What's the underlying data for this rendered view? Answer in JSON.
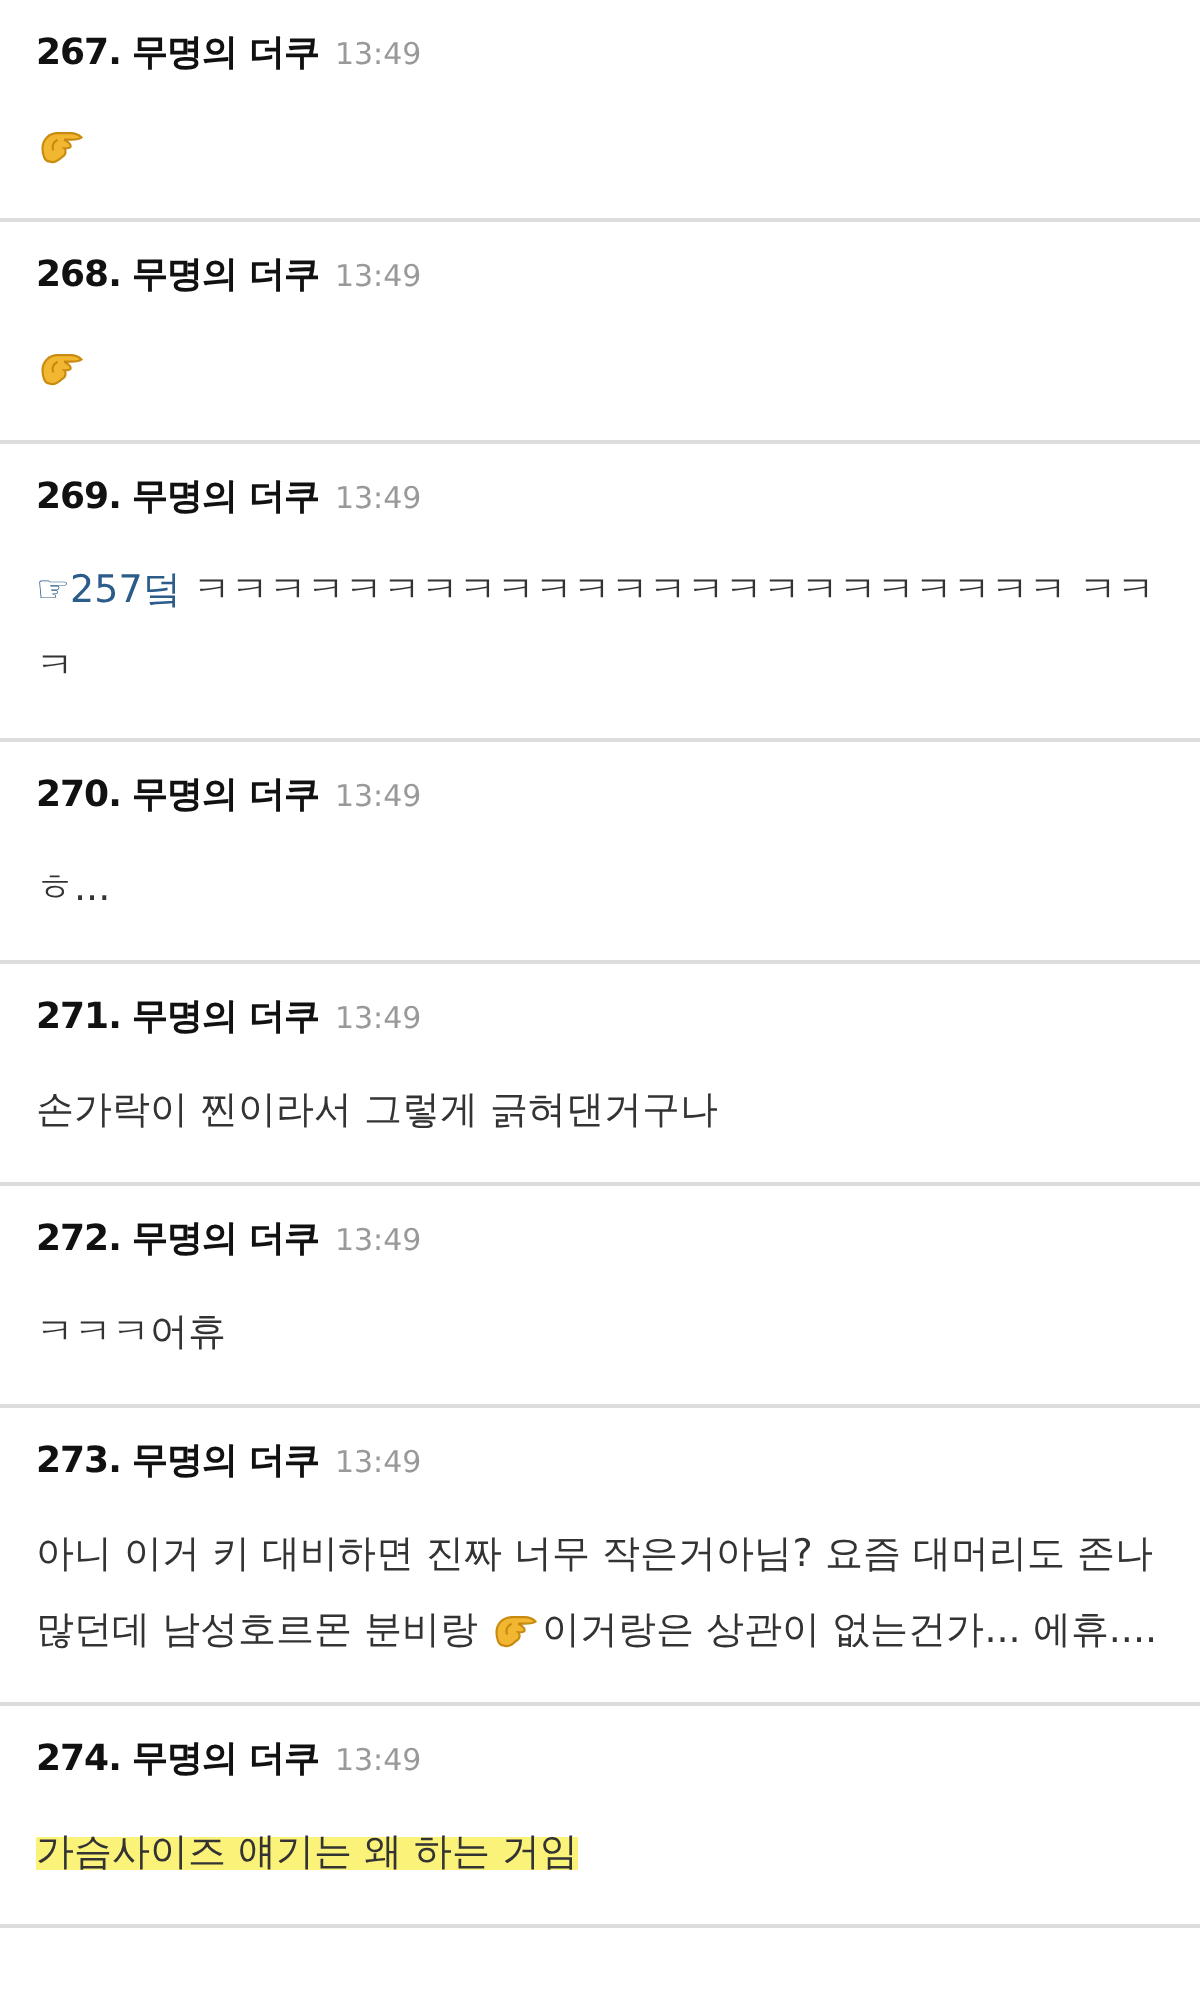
{
  "posts": [
    {
      "number": "267.",
      "author": "무명의 더쿠",
      "time": "13:49",
      "highlighted": false,
      "body": [
        {
          "kind": "emoji"
        }
      ]
    },
    {
      "number": "268.",
      "author": "무명의 더쿠",
      "time": "13:49",
      "highlighted": false,
      "body": [
        {
          "kind": "emoji"
        }
      ]
    },
    {
      "number": "269.",
      "author": "무명의 더쿠",
      "time": "13:49",
      "highlighted": false,
      "body": [
        {
          "kind": "link",
          "text": "☞257덬"
        },
        {
          "kind": "text",
          "text": " ㅋㅋㅋㅋㅋㅋㅋㅋㅋㅋㅋㅋㅋㅋㅋㅋㅋㅋㅋㅋㅋㅋㅋ ㅋㅋㅋ"
        }
      ]
    },
    {
      "number": "270.",
      "author": "무명의 더쿠",
      "time": "13:49",
      "highlighted": false,
      "body": [
        {
          "kind": "text",
          "text": "ㅎ..."
        }
      ]
    },
    {
      "number": "271.",
      "author": "무명의 더쿠",
      "time": "13:49",
      "highlighted": false,
      "body": [
        {
          "kind": "text",
          "text": "손가락이 찐이라서 그렇게 긁혀댄거구나"
        }
      ]
    },
    {
      "number": "272.",
      "author": "무명의 더쿠",
      "time": "13:49",
      "highlighted": false,
      "body": [
        {
          "kind": "text",
          "text": "ㅋㅋㅋ어휴"
        }
      ]
    },
    {
      "number": "273.",
      "author": "무명의 더쿠",
      "time": "13:49",
      "highlighted": false,
      "body": [
        {
          "kind": "text",
          "text": "아니 이거 키 대비하면 진짜 너무 작은거아님? 요즘 대머리도 존나 많던데 남성호르몬 분비랑 "
        },
        {
          "kind": "emoji"
        },
        {
          "kind": "text",
          "text": "이거랑은 상관이 없는건가... 에휴...."
        }
      ]
    },
    {
      "number": "274.",
      "author": "무명의 더쿠",
      "time": "13:49",
      "highlighted": true,
      "body": [
        {
          "kind": "text",
          "text": "가슴사이즈 얘기는 왜 하는 거임"
        }
      ]
    }
  ]
}
